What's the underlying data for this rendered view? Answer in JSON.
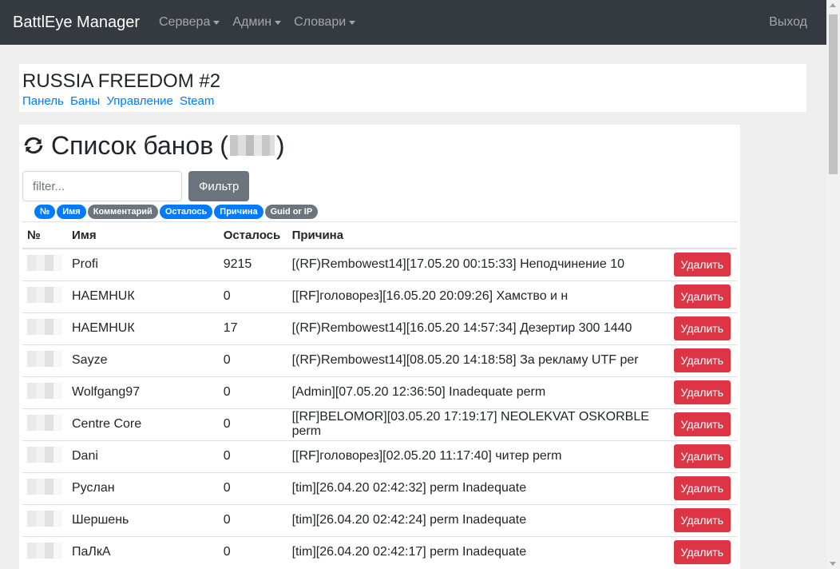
{
  "navbar": {
    "brand": "BattlEye Manager",
    "items": [
      {
        "label": "Сервера"
      },
      {
        "label": "Админ"
      },
      {
        "label": "Словари"
      }
    ],
    "exit": "Выход"
  },
  "server": {
    "title": "RUSSIA FREEDOM #2",
    "links": [
      "Панель",
      "Баны",
      "Управление",
      "Steam"
    ]
  },
  "bans": {
    "title": "Список банов",
    "open_paren": "(",
    "close_paren": ")",
    "filter_placeholder": "filter...",
    "filter_button": "Фильтр",
    "badges": [
      {
        "label": "№",
        "color": "blue"
      },
      {
        "label": "Имя",
        "color": "blue"
      },
      {
        "label": "Комментарий",
        "color": "gray"
      },
      {
        "label": "Осталось",
        "color": "blue"
      },
      {
        "label": "Причина",
        "color": "blue"
      },
      {
        "label": "Guid or IP",
        "color": "gray"
      }
    ],
    "columns": [
      "№",
      "Имя",
      "Осталось",
      "Причина"
    ],
    "delete_label": "Удалить",
    "rows": [
      {
        "name": "Profi",
        "left": "9215",
        "reason": "[(RF)Rembowest14][17.05.20 00:15:33] Неподчинение 10"
      },
      {
        "name": "НАЕМНUК",
        "left": "0",
        "reason": "[[RF]головорез][16.05.20 20:09:26] Хамство и н"
      },
      {
        "name": "НАЕМНUК",
        "left": "17",
        "reason": "[(RF)Rembowest14][16.05.20 14:57:34] Дезертир 300 1440"
      },
      {
        "name": "Sayze",
        "left": "0",
        "reason": "[(RF)Rembowest14][08.05.20 14:18:58] За рекламу UTF per"
      },
      {
        "name": "Wolfgang97",
        "left": "0",
        "reason": "[Admin][07.05.20 12:36:50] Inadequate perm"
      },
      {
        "name": "Centre Core",
        "left": "0",
        "reason": "[[RF]BELOMOR][03.05.20 17:19:17] NEOLEKVAT OSKORBLE perm"
      },
      {
        "name": "Dani",
        "left": "0",
        "reason": "[[RF]головорез][02.05.20 11:17:40] читер perm"
      },
      {
        "name": "Руслан",
        "left": "0",
        "reason": "[tim][26.04.20 02:42:32] perm Inadequate"
      },
      {
        "name": "Шершень",
        "left": "0",
        "reason": "[tim][26.04.20 02:42:24] perm Inadequate"
      },
      {
        "name": "ПаЛкА",
        "left": "0",
        "reason": "[tim][26.04.20 02:42:17] perm Inadequate"
      }
    ]
  },
  "colors": {
    "navbar_bg": "#343a40",
    "link": "#007bff",
    "danger": "#dc3545",
    "secondary": "#6c757d"
  }
}
